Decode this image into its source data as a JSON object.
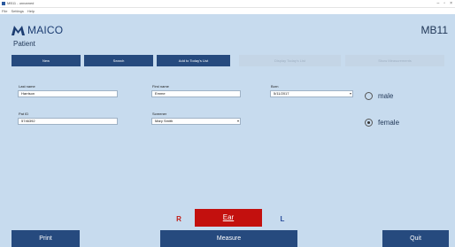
{
  "window": {
    "title": "MB11 - unnamed",
    "controls": [
      "–",
      "▫",
      "×"
    ],
    "menu": [
      "File",
      "Settings",
      "Help"
    ]
  },
  "header": {
    "brand": "MAICO",
    "device": "MB11",
    "section": "Patient"
  },
  "toolbar": {
    "new": "New",
    "search": "Search",
    "add_today": "Add to Today's List",
    "display_today": "Display Today's List",
    "show_measurements": "Show Measurements"
  },
  "form": {
    "last_name_label": "Last name",
    "last_name_value": "Harrison",
    "first_name_label": "First name",
    "first_name_value": "Emme",
    "born_label": "Born",
    "born_value": "5/11/2017",
    "pat_id_label": "Pat ID",
    "pat_id_value": "5746392",
    "screener_label": "Screener",
    "screener_value": "Mary Smith"
  },
  "gender": {
    "male": "male",
    "female": "female",
    "selected": "female"
  },
  "ear": {
    "right": "R",
    "button": "Ear",
    "left": "L"
  },
  "bottom": {
    "print": "Print",
    "measure": "Measure",
    "quit": "Quit"
  },
  "colors": {
    "background": "#c7dbee",
    "button": "#264a7e",
    "ear_red": "#c3100e",
    "left_blue": "#2a4d9b"
  }
}
